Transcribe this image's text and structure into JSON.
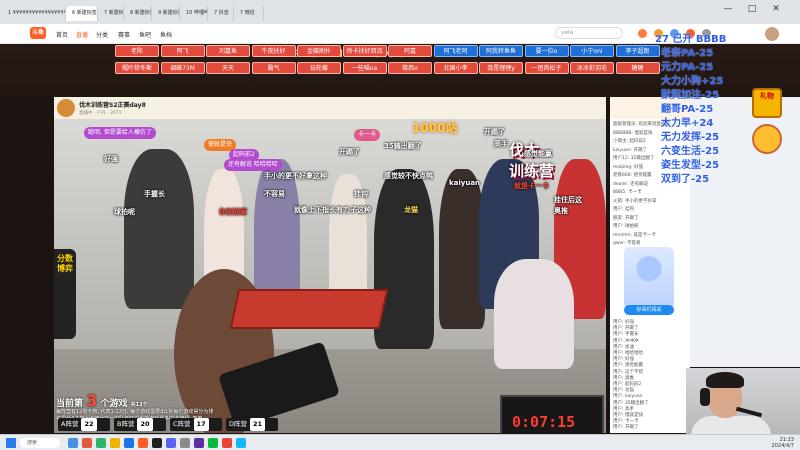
{
  "browser": {
    "tabs": [
      "1 ¥¥¥¥¥¥¥¥¥¥¥¥¥¥¥¥¥¥¥¥¥¥¥¥¥¥¥¥",
      "6 新建标签页",
      "7 新建标签页",
      "8 新建标签页",
      "9 新建标签页",
      "10 哔哩哔哩",
      "7 抖音",
      "7 微信"
    ],
    "window_controls": [
      "—",
      "□",
      "✕"
    ]
  },
  "site": {
    "logo": "斗鱼",
    "nav": [
      "首页",
      "直播",
      "分类",
      "赛事",
      "鱼吧",
      "鱼档"
    ],
    "search_placeholder": "ywlw"
  },
  "banner": {
    "title": "也不能忘 自己代表了光明",
    "chips_row1": [
      "老陈",
      "阿飞",
      "刘嘉鱼",
      "牛夜扶好",
      "金碟刷扑",
      "徐卡扶好回流",
      "阿嘉",
      "阿飞老阿",
      "阿我转鱼鱼",
      "要一拉o",
      "小宁oni",
      "李子超跑"
    ],
    "chips_row2": [
      "帽叶棕冬斯",
      "调峰73M",
      "天天",
      "霸气",
      "玩轮藤",
      "一些喵oa",
      "筷西o",
      "北国小李",
      "我是理理y",
      "一团肉松子",
      "冰冰彩羽毛",
      "糖糖"
    ]
  },
  "room": {
    "title": "伐木训练营S2正赛day8",
    "subtitle": "直播中 · 户外 · 2671"
  },
  "video": {
    "center_logo": "1000站",
    "show_logo": "伐木\n训练营",
    "side_badge": "分数博弈",
    "danmu": [
      {
        "t": "聪明, 但是要给人横仿了",
        "kind": "bubble"
      },
      {
        "t": "卡一卡",
        "kind": "bubble-pink"
      },
      {
        "t": "开踢了",
        "kind": "white"
      },
      {
        "t": "慢就是快",
        "kind": "bubble-orange"
      },
      {
        "t": "起码前2",
        "kind": "bubble"
      },
      {
        "t": "开踢了",
        "kind": "white"
      },
      {
        "t": "35输出翻了",
        "kind": "white"
      },
      {
        "t": "高手",
        "kind": "white"
      },
      {
        "t": "感觉能赢",
        "kind": "white"
      },
      {
        "t": "好强",
        "kind": "white"
      },
      {
        "t": "还有解说 哈哈哈哈",
        "kind": "bubble"
      },
      {
        "t": "手小的更不好拿这种",
        "kind": "white"
      },
      {
        "t": "感觉较不快点鸭",
        "kind": "white"
      },
      {
        "t": "kaiyuan",
        "kind": "white"
      },
      {
        "t": "就是卡一卡",
        "kind": "red"
      },
      {
        "t": "手握长",
        "kind": "white"
      },
      {
        "t": "不容易",
        "kind": "white"
      },
      {
        "t": "挂钩",
        "kind": "white"
      },
      {
        "t": "就像上下指长有力子这种",
        "kind": "white"
      },
      {
        "t": "龙猫",
        "kind": "yellow"
      },
      {
        "t": "球拍呢",
        "kind": "white"
      },
      {
        "t": "你別回家",
        "kind": "red"
      },
      {
        "t": "挂住后这",
        "kind": "white"
      },
      {
        "t": "奥推",
        "kind": "white"
      }
    ],
    "game": {
      "prefix": "当前第",
      "number": "3",
      "suffix": "个游戏",
      "total": "共12个",
      "desc": "每阵营有12张卡牌, 代表1-12分, 每个游戏需要出1张每个游戏得分为排名得分4-1加上卡牌分第一的队伍获得当前游戏最多的卡牌分, 类推。"
    },
    "teams": [
      {
        "name": "A阵营",
        "score": "22"
      },
      {
        "name": "B阵营",
        "score": "20"
      },
      {
        "name": "C阵营",
        "score": "17"
      },
      {
        "name": "D阵营",
        "score": "21"
      }
    ],
    "timer": "0:07:15"
  },
  "chat": {
    "lines": [
      "超级管理员: 欢迎来到直播间",
      "BBBBBB: 慢就是快",
      "小萌主: 起码前2",
      "kaiyuan: 开踢了",
      "用户12: 35输出翻了",
      "mobileg: 好强",
      "老铁666: 感觉能赢",
      "dealer: 还有解说",
      "BBB5: 卡一卡",
      "火箭: 手小的更不好拿",
      "用户: 挂钩",
      "朋友: 开踢了",
      "用户: 球拍呢",
      "mmmm: 就是卡一卡",
      "qwer: 不容易"
    ],
    "lines_bottom": [
      "用户: 好强",
      "用户: 开踢了",
      "用户: 手握长",
      "用户: 冲冲冲",
      "用户: 加油",
      "用户: 哈哈哈哈",
      "用户: 好强",
      "用户: 感觉能赢",
      "用户: 这个不错",
      "用户: 奥推",
      "用户: 起码前2",
      "用户: 龙猫",
      "用户: kaiyuan",
      "用户: 35输出翻了",
      "用户: 高手",
      "用户: 慢就是快",
      "用户: 卡一卡",
      "用户: 开踢了"
    ],
    "mascot_btn": "好哥们闯关"
  },
  "overlay": {
    "items": [
      "27 已开 BBBB",
      "老奈PA-25",
      "元力PA-25",
      "大力小狗+25",
      "默契加注-25",
      "翻哥PA-25",
      "太力早+24",
      "无力发挥-25",
      "六变生活-25",
      "姿生发型-25",
      "双到了-25"
    ],
    "gift_label": "礼物"
  },
  "taskbar": {
    "search": "搜索",
    "time": "21:23",
    "date": "2024/4/7"
  }
}
